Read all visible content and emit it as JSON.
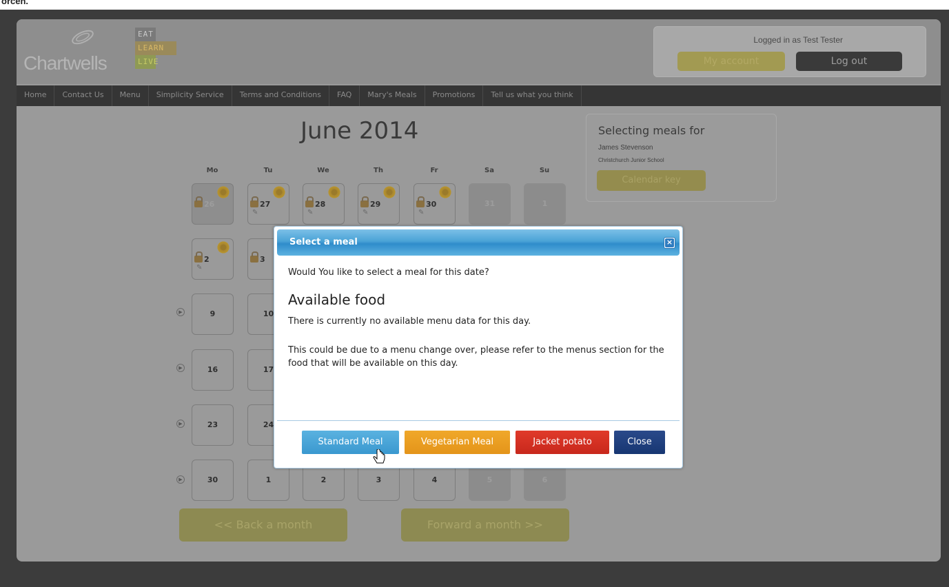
{
  "top_strip_text": "orcen.",
  "logo": {
    "name": "Chartwells",
    "tagline": [
      "EAT",
      "LEARN",
      "LIVE"
    ]
  },
  "account": {
    "logged_in_text": "Logged in as Test Tester",
    "my_account_label": "My account",
    "log_out_label": "Log out"
  },
  "nav": [
    "Home",
    "Contact Us",
    "Menu",
    "Simplicity Service",
    "Terms and Conditions",
    "FAQ",
    "Mary's Meals",
    "Promotions",
    "Tell us what you think"
  ],
  "calendar": {
    "month_title": "June 2014",
    "days_of_week": [
      "Mo",
      "Tu",
      "We",
      "Th",
      "Fr",
      "Sa",
      "Su"
    ],
    "week1": [
      "26",
      "27",
      "28",
      "29",
      "30",
      "31",
      "1"
    ],
    "week2": [
      "2",
      "3"
    ],
    "week3": [
      "9",
      "10"
    ],
    "week4": [
      "16",
      "17"
    ],
    "week5": [
      "23",
      "24"
    ],
    "week6": [
      "30",
      "1",
      "2",
      "3",
      "4",
      "5",
      "6"
    ],
    "back_label": "<< Back a month",
    "forward_label": "Forward a month >>"
  },
  "selecting": {
    "title": "Selecting meals for",
    "name": "James Stevenson",
    "school": "Christchurch Junior School",
    "calendar_key_label": "Calendar key"
  },
  "modal": {
    "title": "Select a meal",
    "question": "Would You like to select a meal for this date?",
    "heading": "Available food",
    "para1": "There is currently no available menu data for this day.",
    "para2": "This could be due to a menu change over, please refer to the menus section for the food that will be available on this day.",
    "buttons": {
      "standard": "Standard Meal",
      "vegetarian": "Vegetarian Meal",
      "jacket": "Jacket potato",
      "close": "Close"
    }
  },
  "colors": {
    "standard": "#3a98cf",
    "vegetarian": "#e4941a",
    "jacket": "#c8281c",
    "close": "#173672"
  }
}
